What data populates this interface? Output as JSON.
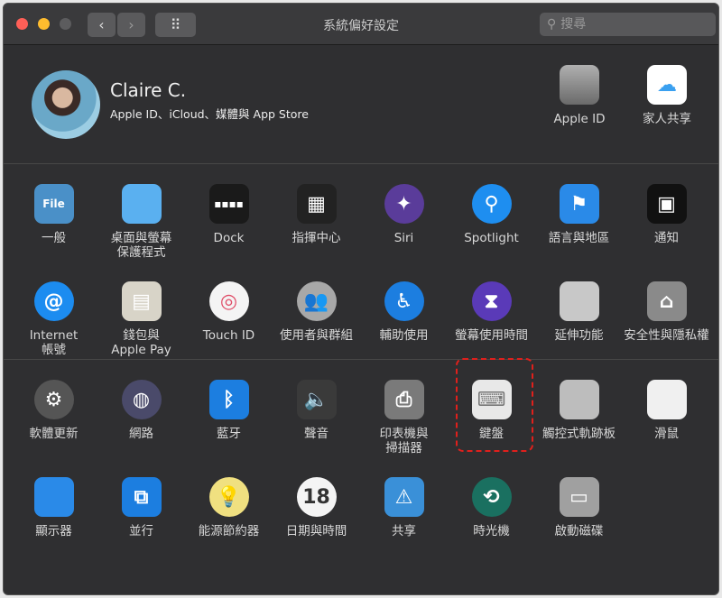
{
  "window": {
    "title": "系統偏好設定",
    "search_placeholder": "搜尋",
    "back": "‹",
    "forward": "›",
    "grid": "⠿"
  },
  "user": {
    "name": "Claire C.",
    "subtitle": "Apple ID、iCloud、媒體與 App Store"
  },
  "top_items": [
    {
      "label": "Apple ID",
      "icon": "apple-icon"
    },
    {
      "label": "家人共享",
      "icon": "family-sharing-icon"
    }
  ],
  "sections": [
    [
      {
        "label": "一般",
        "icon": "general-icon",
        "color": "#4a90c8",
        "glyph": "File"
      },
      {
        "label": "桌面與螢幕\n保護程式",
        "icon": "desktop-icon",
        "color": "#5ab0f0",
        "glyph": ""
      },
      {
        "label": "Dock",
        "icon": "dock-icon",
        "color": "#1a1a1a",
        "glyph": "▪▪▪▪"
      },
      {
        "label": "指揮中心",
        "icon": "mission-control-icon",
        "color": "#222",
        "glyph": "▦"
      },
      {
        "label": "Siri",
        "icon": "siri-icon",
        "color": "#5a3c9a",
        "glyph": "✦",
        "round": true
      },
      {
        "label": "Spotlight",
        "icon": "spotlight-icon",
        "color": "#1e8ef0",
        "glyph": "⚲",
        "round": true
      },
      {
        "label": "語言與地區",
        "icon": "language-region-icon",
        "color": "#2a8ae8",
        "glyph": "⚑"
      },
      {
        "label": "通知",
        "icon": "notifications-icon",
        "color": "#111",
        "glyph": "▣"
      },
      {
        "label": "Internet\n帳號",
        "icon": "internet-accounts-icon",
        "color": "#1c8cf0",
        "glyph": "@",
        "round": true
      },
      {
        "label": "錢包與\nApple Pay",
        "icon": "wallet-icon",
        "color": "#d8d4c8",
        "glyph": "▤"
      },
      {
        "label": "Touch ID",
        "icon": "touch-id-icon",
        "color": "#f4f4f4",
        "glyph": "◎",
        "round": true,
        "dark": "#e0506a"
      },
      {
        "label": "使用者與群組",
        "icon": "users-groups-icon",
        "color": "#a8a8a8",
        "glyph": "👥",
        "round": true
      },
      {
        "label": "輔助使用",
        "icon": "accessibility-icon",
        "color": "#1c7ee0",
        "glyph": "♿",
        "round": true
      },
      {
        "label": "螢幕使用時間",
        "icon": "screen-time-icon",
        "color": "#5a3ab8",
        "glyph": "⧗",
        "round": true
      },
      {
        "label": "延伸功能",
        "icon": "extensions-icon",
        "color": "#c8c8c8",
        "glyph": ""
      },
      {
        "label": "安全性與隱私權",
        "icon": "security-privacy-icon",
        "color": "#8a8a8a",
        "glyph": "⌂"
      }
    ],
    [
      {
        "label": "軟體更新",
        "icon": "software-update-icon",
        "color": "#555",
        "glyph": "⚙",
        "round": true
      },
      {
        "label": "網路",
        "icon": "network-icon",
        "color": "#4a4a6a",
        "glyph": "◍",
        "round": true
      },
      {
        "label": "藍牙",
        "icon": "bluetooth-icon",
        "color": "#1c7ee0",
        "glyph": "ᛒ"
      },
      {
        "label": "聲音",
        "icon": "sound-icon",
        "color": "#3a3a3a",
        "glyph": "🔈"
      },
      {
        "label": "印表機與\n掃描器",
        "icon": "printers-scanners-icon",
        "color": "#7a7a7a",
        "glyph": "⎙"
      },
      {
        "label": "鍵盤",
        "icon": "keyboard-icon",
        "color": "#e8e8e8",
        "glyph": "⌨",
        "dark": "#777",
        "selected": true
      },
      {
        "label": "觸控式軌跡板",
        "icon": "trackpad-icon",
        "color": "#bdbdbd",
        "glyph": ""
      },
      {
        "label": "滑鼠",
        "icon": "mouse-icon",
        "color": "#f0f0f0",
        "glyph": ""
      },
      {
        "label": "顯示器",
        "icon": "displays-icon",
        "color": "#2a8ae8",
        "glyph": ""
      },
      {
        "label": "並行",
        "icon": "sidecar-icon",
        "color": "#1c7ee0",
        "glyph": "⧉"
      },
      {
        "label": "能源節約器",
        "icon": "energy-saver-icon",
        "color": "#f0e080",
        "glyph": "💡",
        "round": true
      },
      {
        "label": "日期與時間",
        "icon": "date-time-icon",
        "color": "#f4f4f4",
        "glyph": "18",
        "dark": "#333",
        "round": true
      },
      {
        "label": "共享",
        "icon": "sharing-icon",
        "color": "#3a90d8",
        "glyph": "⚠"
      },
      {
        "label": "時光機",
        "icon": "time-machine-icon",
        "color": "#1a7060",
        "glyph": "⟲",
        "round": true
      },
      {
        "label": "啟動磁碟",
        "icon": "startup-disk-icon",
        "color": "#a0a0a0",
        "glyph": "▭"
      }
    ]
  ]
}
